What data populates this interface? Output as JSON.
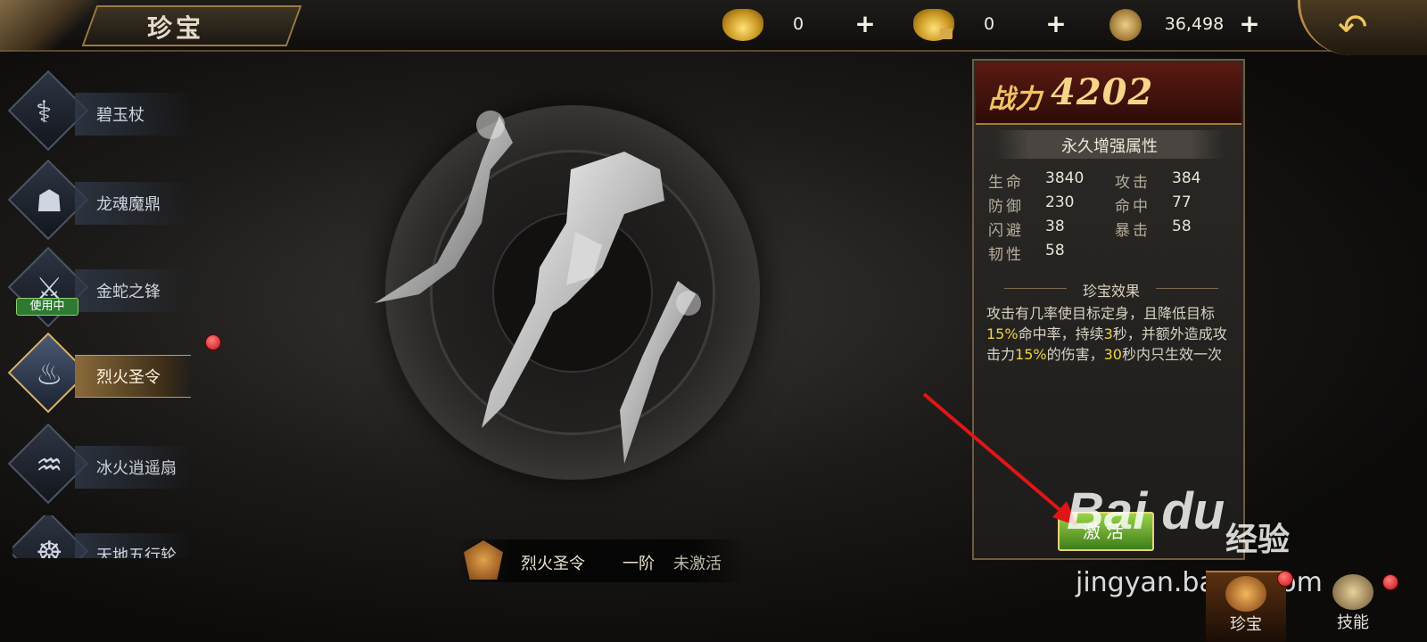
{
  "header": {
    "title": "珍宝",
    "currencies": [
      {
        "icon": "gold-ingot-icon",
        "value": "0",
        "plus": "+"
      },
      {
        "icon": "bound-gold-ingot-icon",
        "value": "0",
        "plus": "+"
      },
      {
        "icon": "copper-coin-icon",
        "value": "36,498",
        "plus": "+"
      }
    ],
    "back_icon": "back-arrow-icon"
  },
  "menu": {
    "items": [
      {
        "label": "碧玉杖",
        "icon": "jade-staff-icon",
        "active": false
      },
      {
        "label": "龙魂魔鼎",
        "icon": "cauldron-icon",
        "active": false
      },
      {
        "label": "金蛇之锋",
        "icon": "snake-blade-icon",
        "active": false,
        "badge": "使用中"
      },
      {
        "label": "烈火圣令",
        "icon": "flame-token-icon",
        "active": true,
        "red_dot": true
      },
      {
        "label": "冰火逍遥扇",
        "icon": "fan-icon",
        "active": false
      },
      {
        "label": "天地五行轮",
        "icon": "wheel-icon",
        "active": false
      }
    ]
  },
  "treasure": {
    "name": "烈火圣令",
    "rank": "一阶",
    "status": "未激活"
  },
  "panel": {
    "power_label": "战力",
    "power_value": "4202",
    "attr_header": "永久增强属性",
    "attributes": [
      {
        "name": "生命",
        "value": "3840"
      },
      {
        "name": "攻击",
        "value": "384"
      },
      {
        "name": "防御",
        "value": "230"
      },
      {
        "name": "命中",
        "value": "77"
      },
      {
        "name": "闪避",
        "value": "38"
      },
      {
        "name": "暴击",
        "value": "58"
      },
      {
        "name": "韧性",
        "value": "58"
      }
    ],
    "effect_title": "珍宝效果",
    "effect": {
      "p1": "攻击有几率使目标定身，且降低目标",
      "h1": "15%",
      "p2": "命中率，持续",
      "h2": "3",
      "p3": "秒，并额外造成攻击力",
      "h3": "15%",
      "p4": "的伤害，",
      "h4": "30",
      "p5": "秒内只生效一次"
    },
    "activate_label": "激活"
  },
  "watermark": {
    "logo": "Bai du",
    "jingyan": "经验",
    "url": "jingyan.baidu.com"
  },
  "bottom_tabs": [
    {
      "label": "珍宝",
      "active": true
    },
    {
      "label": "技能",
      "active": false
    }
  ],
  "colors": {
    "highlight": "#f1d43f",
    "accent_gold": "#c39c58",
    "power": "#f6d58a",
    "activate_green": "#6aa82e"
  }
}
